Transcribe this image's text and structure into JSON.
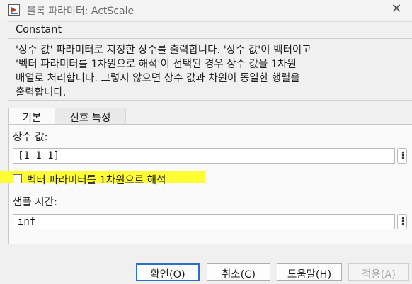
{
  "window": {
    "title": "블록 파라미터: ActScale",
    "close_glyph": "✕"
  },
  "block": {
    "name": "Constant",
    "description_lines": [
      "'상수 값' 파라미터로 지정한 상수를 출력합니다. '상수 값'이 벡터이고",
      "'벡터 파라미터를 1차원으로 해석'이 선택된 경우 상수 값을 1차원",
      "배열로 처리합니다. 그렇지 않으면 상수 값과 차원이 동일한 행렬을",
      "출력합니다."
    ]
  },
  "tabs": [
    {
      "label": "기본",
      "active": true
    },
    {
      "label": "신호 특성",
      "active": false
    }
  ],
  "params": {
    "constant_value_label": "상수 값:",
    "constant_value": "[1 1 1]",
    "interpret_vector_label": "벡터 파라미터를 1차원으로 해석",
    "interpret_vector_checked": false,
    "sample_time_label": "샘플 시간:",
    "sample_time_value": "inf",
    "more_glyph": "⋮"
  },
  "buttons": {
    "ok": "확인(O)",
    "cancel": "취소(C)",
    "help": "도움말(H)",
    "apply": "적용(A)"
  },
  "colors": {
    "highlight": "#ffff33",
    "ok_border": "#2a6fc9"
  }
}
